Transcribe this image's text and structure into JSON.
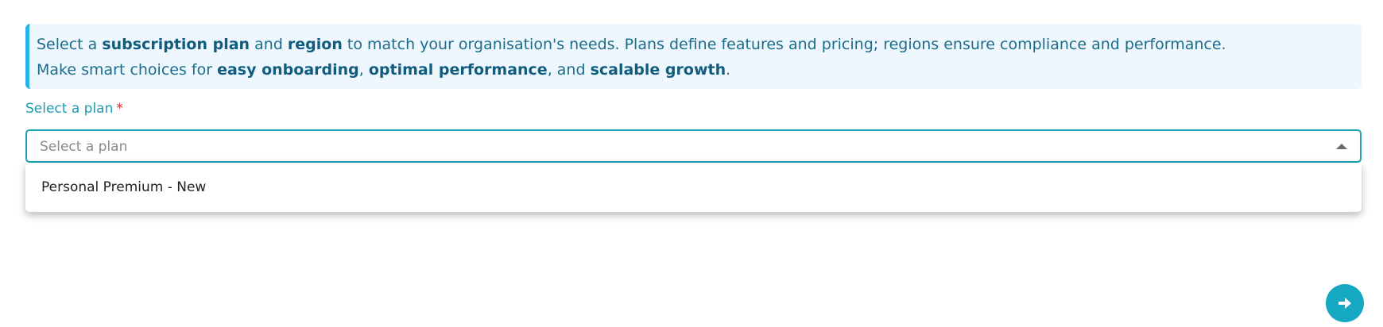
{
  "banner": {
    "line1": {
      "t1": "Select a ",
      "b1": "subscription plan",
      "t2": " and ",
      "b2": "region",
      "t3": " to match your organisation's needs. Plans define features and pricing; regions ensure compliance and performance."
    },
    "line2": {
      "t1": "Make smart choices for ",
      "b1": "easy onboarding",
      "t2": ", ",
      "b2": "optimal performance",
      "t3": ", and ",
      "b3": "scalable growth",
      "t4": "."
    }
  },
  "plan_field": {
    "label": "Select a plan",
    "required_mark": "*",
    "placeholder": "Select a plan",
    "options": [
      "Personal Premium - New"
    ]
  },
  "icons": {
    "dropdown": "caret-up-icon",
    "next": "arrow-right-icon"
  },
  "colors": {
    "accent": "#14a8c2",
    "banner_bg": "#eef7fe",
    "banner_border": "#2ab3e6",
    "required": "#d8232a"
  }
}
